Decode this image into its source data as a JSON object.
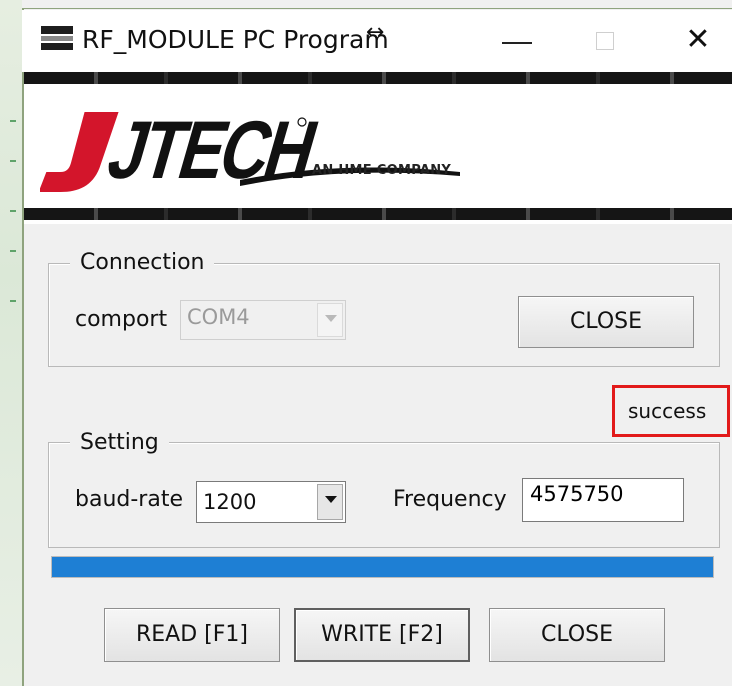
{
  "window": {
    "title": "RF_MODULE PC Program",
    "resize_icon": "↔",
    "close_glyph": "✕"
  },
  "banner": {
    "logo_text": "JTECH",
    "tagline": "AN HME COMPANY"
  },
  "connection": {
    "legend": "Connection",
    "comport_label": "comport",
    "comport_value": "COM4",
    "close_label": "CLOSE"
  },
  "status": {
    "text": "success"
  },
  "setting": {
    "legend": "Setting",
    "baud_label": "baud-rate",
    "baud_value": "1200",
    "frequency_label": "Frequency",
    "frequency_value": "4575750"
  },
  "progress": {
    "fraction": 1.0
  },
  "actions": {
    "read_label": "READ [F1]",
    "write_label": "WRITE [F2]",
    "close_label": "CLOSE"
  },
  "colors": {
    "logo_red": "#d3152b",
    "logo_black": "#111111",
    "progress_blue": "#1e7fd4",
    "highlight_red": "#e21a1a"
  },
  "icons": {
    "app": "app-icon",
    "minimize": "minimize-icon",
    "maximize": "maximize-icon",
    "close": "close-icon",
    "dropdown": "chevron-down-icon"
  }
}
